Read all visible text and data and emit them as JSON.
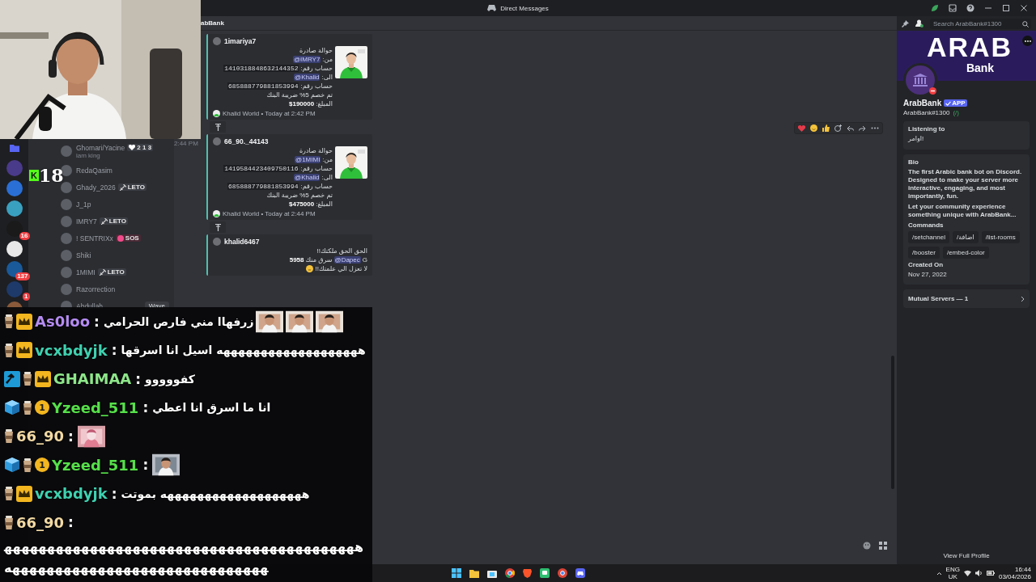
{
  "window": {
    "title": "Direct Messages"
  },
  "servers": [
    {
      "kind": "folder"
    },
    {
      "kind": "server"
    },
    {
      "kind": "server"
    },
    {
      "kind": "server"
    },
    {
      "kind": "server",
      "badge": "16"
    },
    {
      "kind": "server"
    },
    {
      "kind": "server",
      "badge": "137"
    },
    {
      "kind": "server",
      "badge": "1"
    },
    {
      "kind": "server"
    }
  ],
  "members": [
    {
      "name": "Ghomari/Yacine",
      "subtitle": "iam king",
      "tag": {
        "kind": "heart",
        "text": "2 1 3"
      }
    },
    {
      "name": "RedaQasim"
    },
    {
      "name": "Ghady_2026",
      "tag": {
        "kind": "leto",
        "text": "LETO"
      }
    },
    {
      "name": "J_1p"
    },
    {
      "name": "IMRY7",
      "tag": {
        "kind": "leto",
        "text": "LETO"
      }
    },
    {
      "name": "! SENTRIXx",
      "tag": {
        "kind": "sos",
        "text": "SOS"
      }
    },
    {
      "name": "Shiki"
    },
    {
      "name": "1MIMI",
      "tag": {
        "kind": "leto",
        "text": "LETO"
      }
    },
    {
      "name": "Razorrection"
    },
    {
      "name": "Abdullah",
      "action": "Wave"
    }
  ],
  "stream_badge": {
    "logo": "K",
    "label": "18"
  },
  "chat": {
    "header": "abBank",
    "messages": [
      {
        "author": "1imariya7",
        "thumbnail": {
          "kind": "picture"
        },
        "lines": [
          {
            "segments": [
              {
                "text": "حوالة صادرة"
              }
            ]
          },
          {
            "segments": [
              {
                "text": "@IMRY7",
                "kind": "mention"
              },
              {
                "text": "من:"
              }
            ]
          },
          {
            "segments": [
              {
                "text": "1410318848632144352",
                "kind": "code"
              },
              {
                "text": "حساب رقم:"
              }
            ]
          },
          {
            "segments": [
              {
                "text": "@Khalid",
                "kind": "mention"
              },
              {
                "text": "الى:"
              }
            ]
          },
          {
            "segments": [
              {
                "text": "685888779881853994",
                "kind": "code"
              },
              {
                "text": "حساب رقم:"
              }
            ]
          },
          {
            "segments": [
              {
                "text": "تم خصم 5% ضريبة البنك"
              }
            ]
          },
          {
            "segments": [
              {
                "text": "$190000",
                "kind": "bold"
              },
              {
                "text": "المبلغ:"
              }
            ]
          }
        ],
        "footer": "Khalid World • Today at 2:42 PM",
        "pin": true
      },
      {
        "time": "2:44 PM",
        "toolbar": true,
        "author": "66_90._44143",
        "thumbnail": {
          "kind": "picture"
        },
        "lines": [
          {
            "segments": [
              {
                "text": "حوالة صادرة"
              }
            ]
          },
          {
            "segments": [
              {
                "text": "@1MIMI",
                "kind": "mention"
              },
              {
                "text": "من:"
              }
            ]
          },
          {
            "segments": [
              {
                "text": "1419584423409750116",
                "kind": "code"
              },
              {
                "text": "حساب رقم:"
              }
            ]
          },
          {
            "segments": [
              {
                "text": "@Khalid",
                "kind": "mention"
              },
              {
                "text": "الى:"
              }
            ]
          },
          {
            "segments": [
              {
                "text": "685888779881853994",
                "kind": "code"
              },
              {
                "text": "حساب رقم:"
              }
            ]
          },
          {
            "segments": [
              {
                "text": "تم خصم 5% ضريبة البنك"
              }
            ]
          },
          {
            "segments": [
              {
                "text": "$475000",
                "kind": "bold"
              },
              {
                "text": "المبلغ:"
              }
            ]
          }
        ],
        "footer": "Khalid World • Today at 2:44 PM",
        "pin": true
      },
      {
        "author": "khalid6467",
        "lines": [
          {
            "segments": [
              {
                "text": "الحق الحق ملكتك!!"
              }
            ]
          },
          {
            "segments": [
              {
                "text": "5958",
                "kind": "bold"
              },
              {
                "text": "سرق منك"
              },
              {
                "text": "@Dapec",
                "kind": "mention"
              },
              {
                "text": "G"
              }
            ]
          },
          {
            "segments": [
              {
                "text": "لا تعزل الي علمتك!!"
              }
            ],
            "emoji": true
          }
        ]
      }
    ]
  },
  "profile": {
    "search": {
      "placeholder": "Search ArabBank#1300"
    },
    "banner": {
      "title": "ARAB",
      "subtitle": "Bank"
    },
    "name": "ArabBank",
    "badge": "APP",
    "tag": "ArabBank#1300",
    "tag_extra": "(/)",
    "listening": {
      "heading": "Listening to",
      "value": "!اوامر"
    },
    "bio": {
      "heading": "Bio",
      "paragraphs": [
        "The first Arabic bank bot on Discord. Designed to make your server more interactive, engaging, and most importantly, fun.",
        "Let your community experience something unique with ArabBank..."
      ]
    },
    "commands": {
      "heading": "Commands",
      "items": [
        "/setchannel",
        "/اضافة",
        "/list-rooms",
        "/booster",
        "/embed-color"
      ]
    },
    "created": {
      "heading": "Created On",
      "value": "Nov 27, 2022"
    },
    "mutual": "Mutual Servers — 1",
    "view_full": "View Full Profile"
  },
  "overlay_chat": [
    {
      "badges": [
        {
          "kind": "cup"
        },
        {
          "kind": "crown"
        }
      ],
      "name": "As0loo",
      "color": "#b58cf2",
      "sep": ":",
      "message": "زرفهاا مني فارص الحرامي",
      "emotes": [
        {
          "kind": "picture"
        },
        {
          "kind": "picture"
        },
        {
          "kind": "picture"
        }
      ]
    },
    {
      "badges": [
        {
          "kind": "cup"
        },
        {
          "kind": "crown"
        }
      ],
      "name": "vcxbdyjk",
      "color": "#3fd1b0",
      "sep": ":",
      "message": "هههههههههههههههههههه اسيل انا اسرقها"
    },
    {
      "badges": [
        {
          "kind": "hammer"
        },
        {
          "kind": "cup"
        },
        {
          "kind": "crown"
        }
      ],
      "name": "GHAIMAA",
      "color": "#8ee68a",
      "sep": ":",
      "message": "كفووووو"
    },
    {
      "badges": [
        {
          "kind": "cube"
        },
        {
          "kind": "cup"
        },
        {
          "kind": "sub",
          "text": "1"
        }
      ],
      "name": "Yzeed_511",
      "color": "#56e04a",
      "sep": ":",
      "message": "انا ما اسرق انا اعطي"
    },
    {
      "badges": [
        {
          "kind": "cup"
        }
      ],
      "name": "66_90",
      "color": "#f2d9a4",
      "sep": ":",
      "emotes": [
        {
          "kind": "picture"
        }
      ]
    },
    {
      "badges": [
        {
          "kind": "cube"
        },
        {
          "kind": "cup"
        },
        {
          "kind": "sub",
          "text": "1"
        }
      ],
      "name": "Yzeed_511",
      "color": "#56e04a",
      "sep": ":",
      "emotes": [
        {
          "kind": "picture"
        }
      ]
    },
    {
      "badges": [
        {
          "kind": "cup"
        },
        {
          "kind": "crown"
        }
      ],
      "name": "vcxbdyjk",
      "color": "#3fd1b0",
      "sep": ":",
      "message": "هههههههههههههههههههه بموتت"
    },
    {
      "badges": [
        {
          "kind": "cup"
        }
      ],
      "name": "66_90",
      "color": "#f2d9a4",
      "sep": ":",
      "long_message": "ههههههههههههههههههههههههههههههههههههههههههههههههههههههههههههههههههههههههه"
    }
  ],
  "taskbar": {
    "lang": "ENG",
    "region": "UK",
    "time": "16:44",
    "date": "03/04/2026"
  }
}
